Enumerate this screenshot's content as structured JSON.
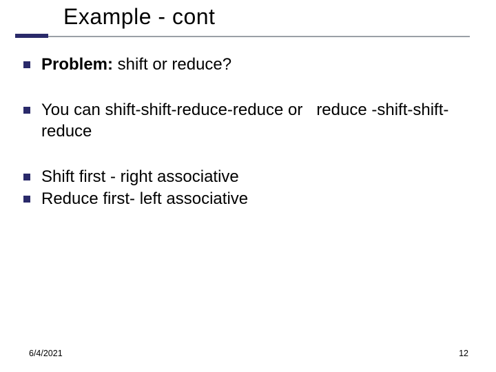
{
  "title": "Example - cont",
  "bullets": {
    "b1_strong": "Problem:",
    "b1_rest": " shift or reduce?",
    "b2": "You can shift-shift-reduce-reduce or   reduce -shift-shift-reduce",
    "b3": "Shift first - right associative",
    "b4": "Reduce first- left associative"
  },
  "footer": {
    "date": "6/4/2021",
    "page": "12"
  }
}
